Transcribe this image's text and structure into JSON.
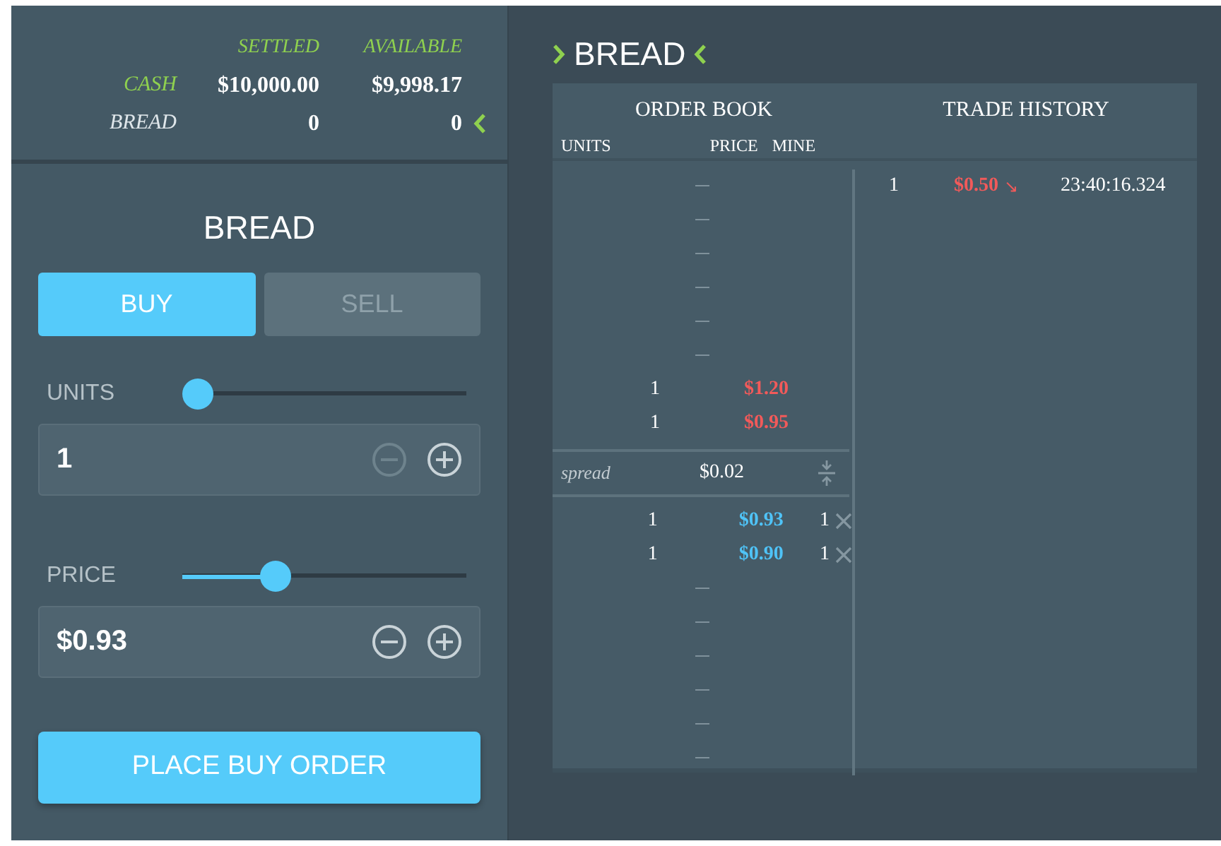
{
  "balances": {
    "columns": [
      "SETTLED",
      "AVAILABLE"
    ],
    "rows": [
      {
        "label": "CASH",
        "kind": "cash",
        "settled": "$10,000.00",
        "available": "$9,998.17",
        "selected": false
      },
      {
        "label": "BREAD",
        "kind": "asset",
        "settled": "0",
        "available": "0",
        "selected": true
      }
    ]
  },
  "order_form": {
    "title": "BREAD",
    "tabs": [
      {
        "label": "BUY",
        "selected": true
      },
      {
        "label": "SELL",
        "selected": false
      }
    ],
    "fields": [
      {
        "label": "UNITS",
        "level": 0,
        "value": "1",
        "decrement_disabled": true
      },
      {
        "label": "PRICE",
        "level": 0.31,
        "value": "$0.93",
        "decrement_disabled": false
      }
    ],
    "submit": "PLACE BUY ORDER"
  },
  "market": {
    "title": "BREAD",
    "order_book": {
      "title": "ORDER BOOK",
      "columns": [
        "UNITS",
        "PRICE",
        "MINE"
      ],
      "asks": [
        {
          "kind": "empty"
        },
        {
          "kind": "empty"
        },
        {
          "kind": "empty"
        },
        {
          "kind": "empty"
        },
        {
          "kind": "empty"
        },
        {
          "kind": "empty"
        },
        {
          "kind": "order",
          "units": "1",
          "price": "$1.20"
        },
        {
          "kind": "order",
          "units": "1",
          "price": "$0.95"
        }
      ],
      "spread": {
        "label": "spread",
        "value": "$0.02"
      },
      "bids": [
        {
          "kind": "order",
          "units": "1",
          "price": "$0.93",
          "mine": "1"
        },
        {
          "kind": "order",
          "units": "1",
          "price": "$0.90",
          "mine": "1"
        },
        {
          "kind": "empty"
        },
        {
          "kind": "empty"
        },
        {
          "kind": "empty"
        },
        {
          "kind": "empty"
        },
        {
          "kind": "empty"
        },
        {
          "kind": "empty"
        }
      ]
    },
    "trade_history": {
      "title": "TRADE HISTORY",
      "trades": [
        {
          "units": "1",
          "price": "$0.50",
          "color": "#f25a5a",
          "arrow": "↘",
          "time": "23:40:16.324"
        }
      ]
    }
  }
}
